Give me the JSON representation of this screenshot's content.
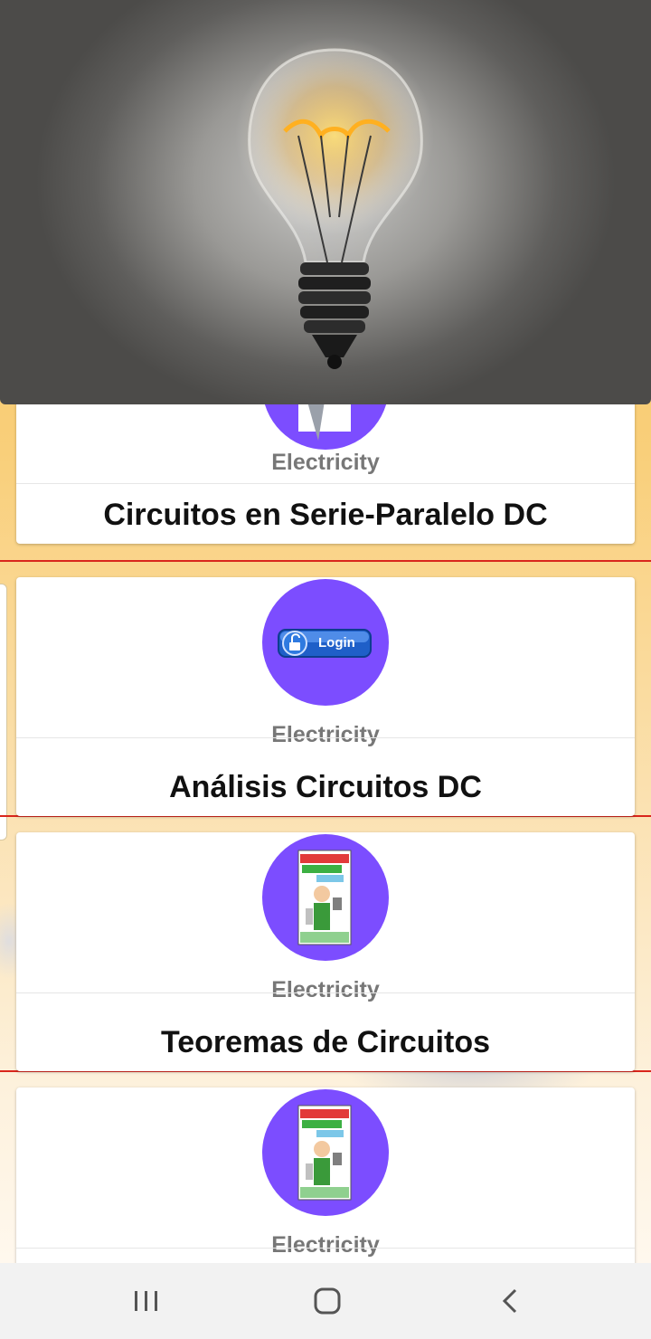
{
  "hero": {
    "image": "light-bulb-photo"
  },
  "cards": [
    {
      "category": "Electricity",
      "title": "Circuitos en Serie-Paralelo DC",
      "icon": "pen-icon"
    },
    {
      "category": "Electricity",
      "title": "Análisis Circuitos DC",
      "icon": "login-badge-icon",
      "icon_text": "Login"
    },
    {
      "category": "Electricity",
      "title": "Teoremas de Circuitos",
      "icon": "electricity-circuit-pro-icon"
    },
    {
      "category": "Electricity",
      "title": "",
      "icon": "electricity-circuit-pro-icon"
    }
  ],
  "colors": {
    "avatar": "#7c4dff",
    "separator": "#d9261c"
  },
  "navbar": {
    "items": [
      "recent-apps-icon",
      "home-icon",
      "back-icon"
    ]
  }
}
